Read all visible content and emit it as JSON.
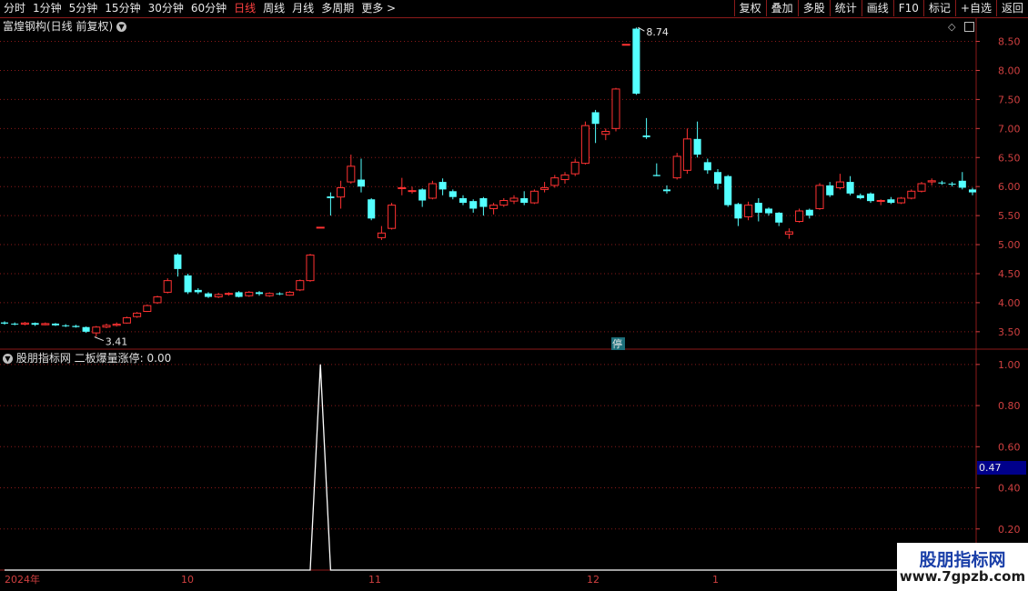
{
  "toolbar": {
    "periods": [
      "分时",
      "1分钟",
      "5分钟",
      "15分钟",
      "30分钟",
      "60分钟",
      "日线",
      "周线",
      "月线",
      "多周期",
      "更多 >"
    ],
    "active_period": "日线",
    "right_buttons": [
      "复权",
      "叠加",
      "多股",
      "统计",
      "画线",
      "F10",
      "标记",
      "+自选",
      "返回"
    ]
  },
  "main_panel": {
    "title": "富煌钢构(日线 前复权)",
    "right_icons": [
      "diamond-icon",
      "layout-icon"
    ]
  },
  "indicator_panel": {
    "title": "股朋指标网 二板爆量涨停: 0.00",
    "current_value": "0.47"
  },
  "watermark": {
    "title": "股朋指标网",
    "url": "www.7gpzb.com"
  },
  "date_labels": [
    {
      "text": "2024年"
    },
    {
      "text": "10"
    },
    {
      "text": "11"
    },
    {
      "text": "12"
    },
    {
      "text": "1"
    }
  ],
  "colors": {
    "up": "#ff3232",
    "down": "#54ffff",
    "grid": "#8b1a1a",
    "axis": "#d04040"
  },
  "chart_data": [
    {
      "type": "candlestick",
      "title": "富煌钢构(日线 前复权)",
      "ylim": [
        3.2,
        8.9
      ],
      "y_ticks": [
        3.5,
        4.0,
        4.5,
        5.0,
        5.5,
        6.0,
        6.5,
        7.0,
        7.5,
        8.0,
        8.5
      ],
      "annotations": [
        {
          "text": "8.74",
          "type": "max"
        },
        {
          "text": "3.41",
          "type": "min"
        },
        {
          "text": "停",
          "type": "suspension"
        }
      ],
      "candles": [
        [
          3.66,
          3.64,
          3.68,
          3.62
        ],
        [
          3.64,
          3.63,
          3.66,
          3.61
        ],
        [
          3.63,
          3.65,
          3.67,
          3.61
        ],
        [
          3.65,
          3.62,
          3.66,
          3.6
        ],
        [
          3.62,
          3.64,
          3.66,
          3.61
        ],
        [
          3.64,
          3.61,
          3.65,
          3.6
        ],
        [
          3.61,
          3.6,
          3.63,
          3.58
        ],
        [
          3.6,
          3.58,
          3.62,
          3.57
        ],
        [
          3.58,
          3.5,
          3.59,
          3.48
        ],
        [
          3.48,
          3.58,
          3.6,
          3.41
        ],
        [
          3.58,
          3.61,
          3.64,
          3.56
        ],
        [
          3.61,
          3.63,
          3.66,
          3.59
        ],
        [
          3.65,
          3.74,
          3.76,
          3.64
        ],
        [
          3.76,
          3.82,
          3.84,
          3.74
        ],
        [
          3.85,
          3.95,
          3.97,
          3.84
        ],
        [
          4.0,
          4.1,
          4.12,
          3.98
        ],
        [
          4.18,
          4.38,
          4.42,
          4.16
        ],
        [
          4.83,
          4.58,
          4.85,
          4.45
        ],
        [
          4.47,
          4.18,
          4.5,
          4.15
        ],
        [
          4.22,
          4.18,
          4.25,
          4.15
        ],
        [
          4.16,
          4.1,
          4.18,
          4.08
        ],
        [
          4.1,
          4.14,
          4.17,
          4.08
        ],
        [
          4.15,
          4.16,
          4.18,
          4.12
        ],
        [
          4.18,
          4.1,
          4.2,
          4.09
        ],
        [
          4.12,
          4.18,
          4.2,
          4.1
        ],
        [
          4.18,
          4.15,
          4.2,
          4.12
        ],
        [
          4.12,
          4.16,
          4.18,
          4.1
        ],
        [
          4.16,
          4.15,
          4.18,
          4.13
        ],
        [
          4.13,
          4.18,
          4.2,
          4.12
        ],
        [
          4.22,
          4.38,
          4.4,
          4.2
        ],
        [
          4.38,
          4.82,
          4.84,
          4.36
        ],
        [
          5.3,
          5.3,
          5.3,
          5.3
        ],
        [
          5.83,
          5.8,
          5.9,
          5.5
        ],
        [
          5.82,
          5.98,
          6.1,
          5.62
        ],
        [
          6.08,
          6.35,
          6.55,
          6.05
        ],
        [
          6.12,
          6.0,
          6.48,
          5.9
        ],
        [
          5.78,
          5.45,
          5.8,
          5.42
        ],
        [
          5.12,
          5.2,
          5.32,
          5.08
        ],
        [
          5.28,
          5.68,
          5.72,
          5.26
        ],
        [
          5.98,
          5.98,
          6.15,
          5.85
        ],
        [
          5.92,
          5.93,
          6.0,
          5.88
        ],
        [
          5.95,
          5.76,
          5.97,
          5.65
        ],
        [
          5.8,
          6.05,
          6.1,
          5.78
        ],
        [
          6.08,
          5.95,
          6.14,
          5.85
        ],
        [
          5.92,
          5.82,
          5.95,
          5.78
        ],
        [
          5.8,
          5.72,
          5.85,
          5.68
        ],
        [
          5.75,
          5.62,
          5.78,
          5.55
        ],
        [
          5.8,
          5.65,
          5.82,
          5.5
        ],
        [
          5.62,
          5.68,
          5.72,
          5.52
        ],
        [
          5.68,
          5.76,
          5.8,
          5.65
        ],
        [
          5.75,
          5.8,
          5.85,
          5.7
        ],
        [
          5.8,
          5.72,
          5.92,
          5.68
        ],
        [
          5.72,
          5.92,
          5.95,
          5.7
        ],
        [
          5.95,
          5.98,
          6.08,
          5.9
        ],
        [
          6.02,
          6.15,
          6.2,
          5.98
        ],
        [
          6.12,
          6.2,
          6.25,
          6.05
        ],
        [
          6.22,
          6.42,
          6.48,
          6.18
        ],
        [
          6.4,
          7.05,
          7.12,
          6.38
        ],
        [
          7.28,
          7.08,
          7.32,
          6.75
        ],
        [
          6.9,
          6.95,
          7.0,
          6.8
        ],
        [
          7.0,
          7.68,
          7.7,
          6.95
        ],
        [
          8.45,
          8.45,
          8.45,
          8.45
        ],
        [
          8.72,
          7.6,
          8.74,
          7.58
        ],
        [
          6.88,
          6.85,
          7.18,
          6.82
        ],
        [
          6.2,
          6.18,
          6.4,
          6.18
        ],
        [
          5.95,
          5.92,
          6.02,
          5.88
        ],
        [
          6.15,
          6.52,
          6.58,
          6.12
        ],
        [
          6.28,
          6.82,
          7.0,
          6.22
        ],
        [
          6.82,
          6.55,
          7.12,
          6.5
        ],
        [
          6.42,
          6.28,
          6.48,
          6.22
        ],
        [
          6.25,
          6.05,
          6.3,
          5.95
        ],
        [
          6.18,
          5.68,
          6.2,
          5.65
        ],
        [
          5.7,
          5.45,
          5.72,
          5.32
        ],
        [
          5.48,
          5.68,
          5.74,
          5.42
        ],
        [
          5.72,
          5.55,
          5.8,
          5.4
        ],
        [
          5.62,
          5.54,
          5.64,
          5.5
        ],
        [
          5.55,
          5.38,
          5.56,
          5.32
        ],
        [
          5.18,
          5.22,
          5.28,
          5.1
        ],
        [
          5.4,
          5.58,
          5.62,
          5.38
        ],
        [
          5.6,
          5.5,
          5.62,
          5.45
        ],
        [
          5.62,
          6.02,
          6.06,
          5.6
        ],
        [
          6.02,
          5.85,
          6.08,
          5.82
        ],
        [
          5.98,
          6.08,
          6.22,
          5.95
        ],
        [
          6.08,
          5.88,
          6.18,
          5.85
        ],
        [
          5.85,
          5.8,
          5.88,
          5.78
        ],
        [
          5.88,
          5.75,
          5.9,
          5.72
        ],
        [
          5.75,
          5.76,
          5.78,
          5.68
        ],
        [
          5.78,
          5.72,
          5.82,
          5.7
        ],
        [
          5.72,
          5.8,
          5.82,
          5.7
        ],
        [
          5.8,
          5.92,
          5.95,
          5.78
        ],
        [
          5.92,
          6.05,
          6.08,
          5.9
        ],
        [
          6.08,
          6.1,
          6.14,
          6.02
        ],
        [
          6.07,
          6.06,
          6.1,
          6.03
        ],
        [
          6.05,
          6.04,
          6.08,
          6.0
        ],
        [
          6.1,
          5.98,
          6.25,
          5.95
        ],
        [
          5.95,
          5.9,
          5.98,
          5.85
        ]
      ]
    },
    {
      "type": "line",
      "title": "股朋指标网 二板爆量涨停",
      "ylim": [
        0,
        1.07
      ],
      "y_ticks": [
        0.2,
        0.4,
        0.6,
        0.8,
        1.0
      ],
      "values": [
        0,
        0,
        0,
        0,
        0,
        0,
        0,
        0,
        0,
        0,
        0,
        0,
        0,
        0,
        0,
        0,
        0,
        0,
        0,
        0,
        0,
        0,
        0,
        0,
        0,
        0,
        0,
        0,
        0,
        0,
        0,
        1,
        0,
        0,
        0,
        0,
        0,
        0,
        0,
        0,
        0,
        0,
        0,
        0,
        0,
        0,
        0,
        0,
        0,
        0,
        0,
        0,
        0,
        0,
        0,
        0,
        0,
        0,
        0,
        0,
        0,
        0,
        0,
        0,
        0,
        0,
        0,
        0,
        0,
        0,
        0,
        0,
        0,
        0,
        0,
        0,
        0,
        0,
        0,
        0,
        0,
        0,
        0,
        0,
        0,
        0,
        0,
        0,
        0,
        0,
        0,
        0,
        0,
        0,
        0,
        0
      ]
    }
  ]
}
